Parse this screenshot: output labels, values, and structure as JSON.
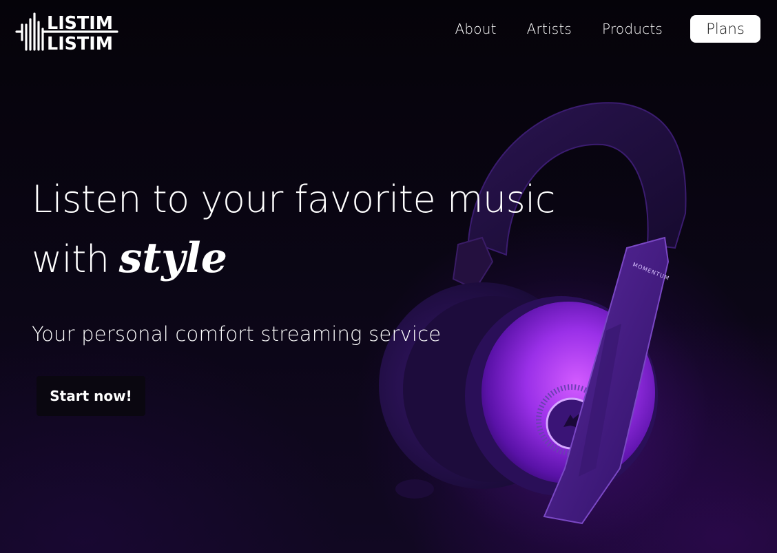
{
  "brand": {
    "logo_text": "LISTIM"
  },
  "nav": {
    "items": [
      {
        "label": "About"
      },
      {
        "label": "Artists"
      },
      {
        "label": "Products"
      }
    ],
    "plans_label": "Plans"
  },
  "hero": {
    "line1": "Listen to your favorite music",
    "line2_prefix": "with",
    "line2_emphasis": "style",
    "subtitle": "Your personal comfort streaming service",
    "cta_label": "Start now!"
  },
  "product_image": {
    "brand_text": "MOMENTUM"
  },
  "colors": {
    "background": "#06030b",
    "accent_purple": "#a33cf0",
    "plans_button_bg": "#ffffff",
    "cta_bg": "#0a0710",
    "text": "#ffffff"
  }
}
